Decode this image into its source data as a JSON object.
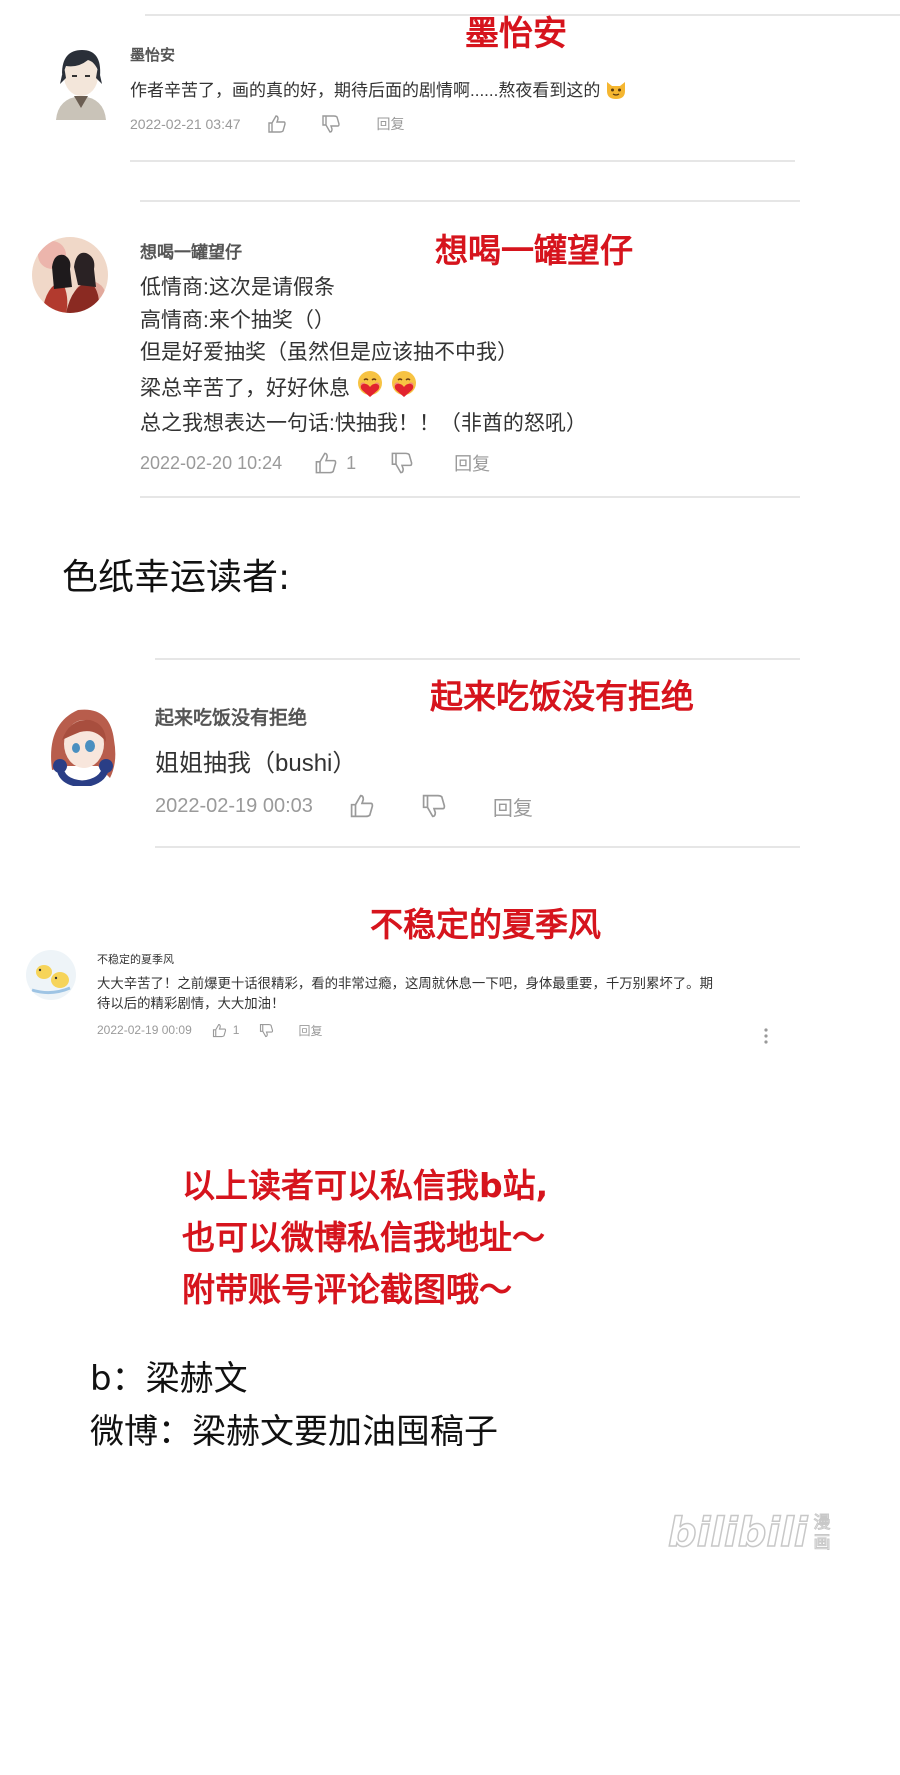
{
  "colors": {
    "accent_red": "#d6141d",
    "divider": "#e6e6e6",
    "meta_gray": "#9a9a9a"
  },
  "comments": [
    {
      "red_label": "墨怡安",
      "username": "墨怡安",
      "lines": [
        "作者辛苦了，画的真的好，期待后面的剧情啊......熬夜看到这的"
      ],
      "date": "2022-02-21 03:47",
      "like_count": "",
      "reply_label": "回复",
      "emoji": "cat-face-icon"
    },
    {
      "red_label": "想喝一罐望仔",
      "username": "想喝一罐望仔",
      "lines": [
        "低情商:这次是请假条",
        "高情商:来个抽奖（）",
        "但是好爱抽奖（虽然但是应该抽不中我）",
        "梁总辛苦了，好好休息",
        "总之我想表达一句话:快抽我！！（非酋的怒吼）"
      ],
      "date": "2022-02-20 10:24",
      "like_count": "1",
      "reply_label": "回复",
      "emoji": "heart-hug-face-icon"
    },
    {
      "red_label": "起来吃饭没有拒绝",
      "username": "起来吃饭没有拒绝",
      "lines": [
        "姐姐抽我（bushi）"
      ],
      "date": "2022-02-19 00:03",
      "like_count": "",
      "reply_label": "回复"
    },
    {
      "red_label": "不稳定的夏季风",
      "username": "不稳定的夏季风",
      "lines": [
        "大大辛苦了！之前爆更十话很精彩，看的非常过瘾，这周就休息一下吧，身体最重要，千万别累坏了。期",
        "待以后的精彩剧情，大大加油！"
      ],
      "date": "2022-02-19 00:09",
      "like_count": "1",
      "reply_label": "回复",
      "more_icon": "more-vertical-icon"
    }
  ],
  "winners_heading": "色纸幸运读者:",
  "notice_lines": [
    "以上读者可以私信我b站,",
    "也可以微博私信我地址～",
    "附带账号评论截图哦～"
  ],
  "contacts": [
    "b：梁赫文",
    "微博：梁赫文要加油囤稿子"
  ],
  "watermark": {
    "text": "bilibili",
    "sub": "漫画"
  }
}
